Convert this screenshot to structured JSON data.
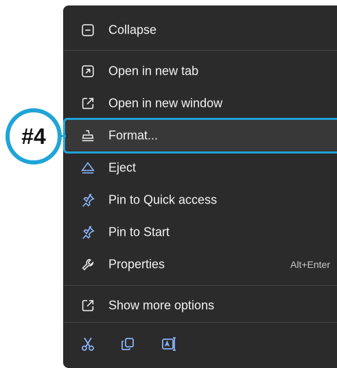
{
  "colors": {
    "menu_bg": "#2b2b2b",
    "accent": "#1fa4d8",
    "text": "#f2f2f2",
    "icon": "#8ab4f8"
  },
  "annotation": {
    "badge_label": "#4"
  },
  "menu": {
    "items": [
      {
        "label": "Collapse",
        "icon": "collapse-icon",
        "shortcut": ""
      },
      {
        "label": "Open in new tab",
        "icon": "open-new-tab-icon",
        "shortcut": ""
      },
      {
        "label": "Open in new window",
        "icon": "open-new-window-icon",
        "shortcut": ""
      },
      {
        "label": "Format...",
        "icon": "format-drive-icon",
        "shortcut": "",
        "highlighted": true
      },
      {
        "label": "Eject",
        "icon": "eject-icon",
        "shortcut": ""
      },
      {
        "label": "Pin to Quick access",
        "icon": "pin-icon",
        "shortcut": ""
      },
      {
        "label": "Pin to Start",
        "icon": "pin-icon",
        "shortcut": ""
      },
      {
        "label": "Properties",
        "icon": "wrench-icon",
        "shortcut": "Alt+Enter"
      },
      {
        "label": "Show more options",
        "icon": "show-more-options-icon",
        "shortcut": ""
      }
    ],
    "bottom_tools": [
      {
        "name": "cut",
        "icon": "scissors-icon"
      },
      {
        "name": "copy",
        "icon": "copy-icon"
      },
      {
        "name": "rename",
        "icon": "rename-icon"
      }
    ]
  }
}
